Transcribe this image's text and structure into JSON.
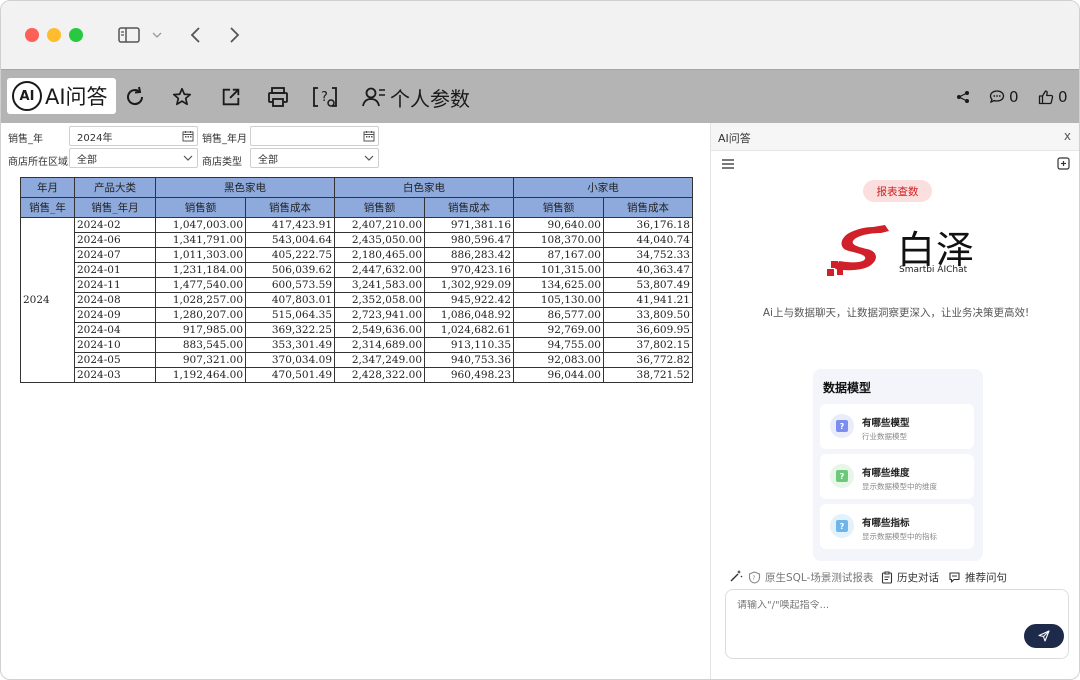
{
  "toolbar": {
    "ai_label": "AI问答",
    "ai_logo_text": "AI",
    "personal_params_label": "个人参数",
    "comment_count": "0",
    "like_count": "0"
  },
  "filters": {
    "sale_year_label": "销售_年",
    "sale_year_value": "2024年",
    "sale_yearmonth_label": "销售_年月",
    "sale_yearmonth_value": "",
    "store_region_label": "商店所在区域",
    "store_region_value": "全部",
    "store_type_label": "商店类型",
    "store_type_value": "全部"
  },
  "report": {
    "header1": [
      "年月",
      "产品大类",
      "黑色家电",
      "白色家电",
      "小家电"
    ],
    "header2": [
      "销售_年",
      "销售_年月",
      "销售额",
      "销售成本",
      "销售额",
      "销售成本",
      "销售额",
      "销售成本"
    ],
    "year": "2024",
    "rows": [
      {
        "month": "2024-02",
        "cells": [
          "1,047,003.00",
          "417,423.91",
          "2,407,210.00",
          "971,381.16",
          "90,640.00",
          "36,176.18"
        ]
      },
      {
        "month": "2024-06",
        "cells": [
          "1,341,791.00",
          "543,004.64",
          "2,435,050.00",
          "980,596.47",
          "108,370.00",
          "44,040.74"
        ]
      },
      {
        "month": "2024-07",
        "cells": [
          "1,011,303.00",
          "405,222.75",
          "2,180,465.00",
          "886,283.42",
          "87,167.00",
          "34,752.33"
        ]
      },
      {
        "month": "2024-01",
        "cells": [
          "1,231,184.00",
          "506,039.62",
          "2,447,632.00",
          "970,423.16",
          "101,315.00",
          "40,363.47"
        ]
      },
      {
        "month": "2024-11",
        "cells": [
          "1,477,540.00",
          "600,573.59",
          "3,241,583.00",
          "1,302,929.09",
          "134,625.00",
          "53,807.49"
        ]
      },
      {
        "month": "2024-08",
        "cells": [
          "1,028,257.00",
          "407,803.01",
          "2,352,058.00",
          "945,922.42",
          "105,130.00",
          "41,941.21"
        ]
      },
      {
        "month": "2024-09",
        "cells": [
          "1,280,207.00",
          "515,064.35",
          "2,723,941.00",
          "1,086,048.92",
          "86,577.00",
          "33,809.50"
        ]
      },
      {
        "month": "2024-04",
        "cells": [
          "917,985.00",
          "369,322.25",
          "2,549,636.00",
          "1,024,682.61",
          "92,769.00",
          "36,609.95"
        ]
      },
      {
        "month": "2024-10",
        "cells": [
          "883,545.00",
          "353,301.49",
          "2,314,689.00",
          "913,110.35",
          "94,755.00",
          "37,802.15"
        ]
      },
      {
        "month": "2024-05",
        "cells": [
          "907,321.00",
          "370,034.09",
          "2,347,249.00",
          "940,753.36",
          "92,083.00",
          "36,772.82"
        ]
      },
      {
        "month": "2024-03",
        "cells": [
          "1,192,464.00",
          "470,501.49",
          "2,428,322.00",
          "960,498.23",
          "96,044.00",
          "38,721.52"
        ]
      }
    ]
  },
  "chat": {
    "title": "AI问答",
    "close": "x",
    "pill": "报表查数",
    "brand_cn": "白泽",
    "brand_en": "Smartbi AIChat",
    "tagline": "Ai上与数据聊天，让数据洞察更深入，让业务决策更高效!",
    "model_card_title": "数据模型",
    "model_items": [
      {
        "name": "有哪些模型",
        "desc": "行业数据模型"
      },
      {
        "name": "有哪些维度",
        "desc": "显示数据模型中的维度"
      },
      {
        "name": "有哪些指标",
        "desc": "显示数据模型中的指标"
      }
    ],
    "quick_sql": "原生SQL-场景测试报表",
    "quick_history": "历史对话",
    "quick_recommend": "推荐问句",
    "input_placeholder": "请输入\"/\"唤起指令..."
  },
  "colors": {
    "header_blue": "#8eaadc",
    "brand_red": "#d0202a",
    "send_navy": "#1e2a4a"
  }
}
